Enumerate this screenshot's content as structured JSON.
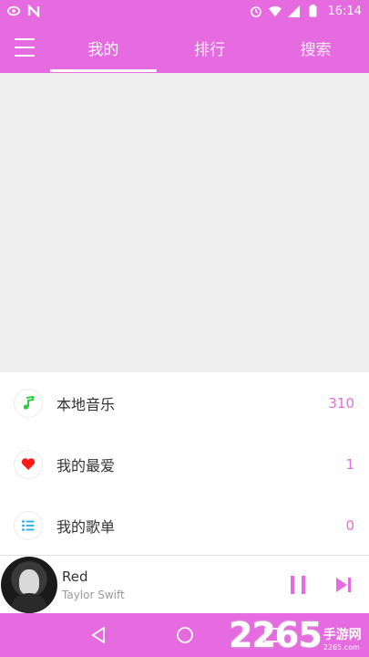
{
  "status_bar": {
    "time": "16:14",
    "icons": [
      "cast-icon",
      "n-app-icon",
      "alarm-icon",
      "wifi-icon",
      "signal-icon",
      "battery-icon"
    ]
  },
  "app_bar": {
    "menu_icon": "hamburger-menu-icon",
    "tabs": [
      {
        "label": "我的",
        "active": true
      },
      {
        "label": "排行",
        "active": false
      },
      {
        "label": "搜索",
        "active": false
      }
    ]
  },
  "library": {
    "items": [
      {
        "label": "本地音乐",
        "count": "310",
        "icon": "music-note-icon",
        "icon_color": "#2ecc40"
      },
      {
        "label": "我的最爱",
        "count": "1",
        "icon": "heart-icon",
        "icon_color": "#ff1a1a"
      },
      {
        "label": "我的歌单",
        "count": "0",
        "icon": "playlist-icon",
        "icon_color": "#29a9e6"
      }
    ]
  },
  "player": {
    "title": "Red",
    "artist": "Taylor Swift",
    "controls": [
      "pause-icon",
      "skip-next-icon"
    ]
  },
  "nav_bar": {
    "buttons": [
      "back-icon",
      "home-icon",
      "recents-icon"
    ]
  },
  "watermark": {
    "number": "2265",
    "text": "手游网",
    "url": "2265.com"
  },
  "colors": {
    "accent": "#e66ae0",
    "count_text": "#e66ae0"
  }
}
